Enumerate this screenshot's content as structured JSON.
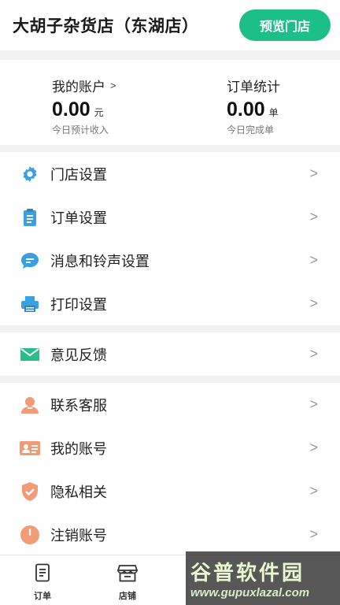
{
  "header": {
    "store_name": "大胡子杂货店（东湖店）",
    "preview_button": "预览门店"
  },
  "stats": {
    "account": {
      "title": "我的账户",
      "value": "0.00",
      "unit": "元",
      "sub": "今日预计收入"
    },
    "orders": {
      "title": "订单统计",
      "value": "0.00",
      "unit": "单",
      "sub": "今日完成单"
    }
  },
  "menu_group1": [
    {
      "label": "门店设置",
      "icon": "gear-icon"
    },
    {
      "label": "订单设置",
      "icon": "clipboard-icon"
    },
    {
      "label": "消息和铃声设置",
      "icon": "chat-bubble-icon"
    },
    {
      "label": "打印设置",
      "icon": "printer-icon"
    }
  ],
  "menu_group2": [
    {
      "label": "意见反馈",
      "icon": "envelope-icon"
    }
  ],
  "menu_group3": [
    {
      "label": "联系客服",
      "icon": "support-agent-icon"
    },
    {
      "label": "我的账号",
      "icon": "id-card-icon"
    },
    {
      "label": "隐私相关",
      "icon": "shield-check-icon"
    },
    {
      "label": "注销账号",
      "icon": "power-icon"
    }
  ],
  "tabbar": [
    {
      "label": "订单",
      "icon": "order-document-icon"
    },
    {
      "label": "店铺",
      "icon": "shop-icon"
    }
  ],
  "watermark": {
    "title": "谷普软件园",
    "url": "www.gupuxlazal.com"
  },
  "colors": {
    "accent": "#1dbf88",
    "blue_icon": "#3aa0e0",
    "teal_icon": "#2dbd8c",
    "orange_icon": "#f39a76"
  }
}
